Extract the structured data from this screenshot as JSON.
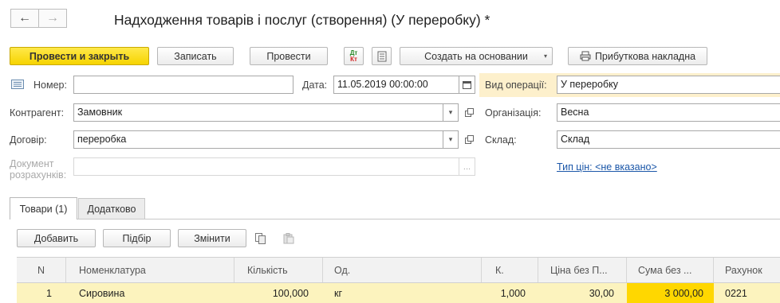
{
  "window": {
    "title": "Надходження товарів і послуг (створення) (У переробку) *",
    "back_icon": "←",
    "forward_icon": "→"
  },
  "toolbar": {
    "post_close_label": "Провести и закрыть",
    "save_label": "Записать",
    "post_label": "Провести",
    "dtkt_top": "Дт",
    "dtkt_bottom": "Кт",
    "create_based_label": "Создать на основании",
    "print_label": "Прибуткова накладна"
  },
  "form": {
    "number_label": "Номер:",
    "number_value": "",
    "date_label": "Дата:",
    "date_value": "11.05.2019 00:00:00",
    "operation_label": "Вид операції:",
    "operation_value": "У переробку",
    "contractor_label": "Контрагент:",
    "contractor_value": "Замовник",
    "organization_label": "Організація:",
    "organization_value": "Весна",
    "contract_label": "Договір:",
    "contract_value": "переробка",
    "warehouse_label": "Склад:",
    "warehouse_value": "Склад",
    "settlement_label_1": "Документ",
    "settlement_label_2": "розрахунків:",
    "settlement_value": "",
    "settlement_dots": "...",
    "price_type_link": "Тип цін: <не вказано>"
  },
  "tabs": [
    {
      "label": "Товари (1)",
      "active": true
    },
    {
      "label": "Додатково",
      "active": false
    }
  ],
  "table_toolbar": {
    "add_label": "Добавить",
    "pick_label": "Підбір",
    "change_label": "Змінити"
  },
  "table": {
    "columns": [
      "N",
      "Номенклатура",
      "Кількість",
      "Од.",
      "К.",
      "Ціна без П...",
      "Сума без ...",
      "Рахунок"
    ],
    "rows": [
      {
        "n": "1",
        "item": "Сировина",
        "qty": "100,000",
        "unit": "кг",
        "k": "1,000",
        "price": "30,00",
        "sum": "3 000,00",
        "account": "0221"
      }
    ]
  },
  "colors": {
    "primary_button": "#f6d400",
    "selected_row": "#fcf3be",
    "selected_cell": "#ffd700",
    "operation_highlight": "#fdf0cc",
    "link": "#1a56a8"
  }
}
